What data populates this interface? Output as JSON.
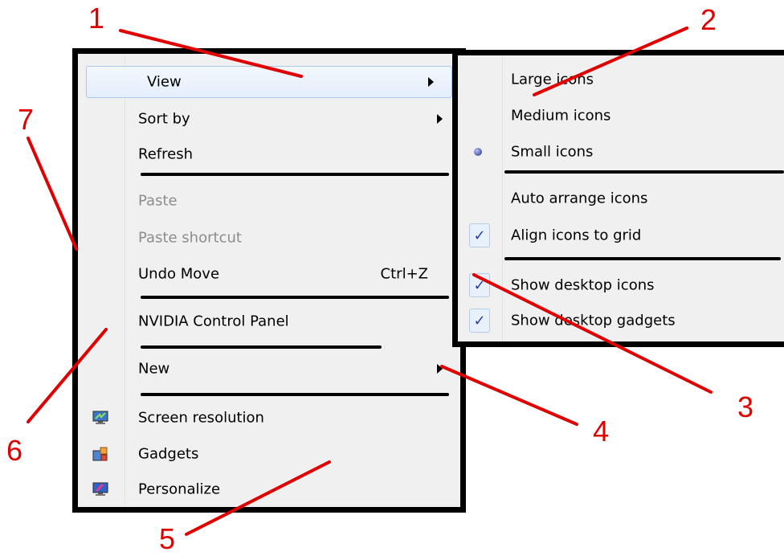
{
  "context_menu": {
    "items": [
      {
        "label": "View",
        "has_submenu": true,
        "highlighted": true
      },
      {
        "label": "Sort by",
        "has_submenu": true
      },
      {
        "label": "Refresh"
      },
      {
        "label": "Paste",
        "disabled": true
      },
      {
        "label": "Paste shortcut",
        "disabled": true
      },
      {
        "label": "Undo Move",
        "shortcut": "Ctrl+Z"
      },
      {
        "label": "NVIDIA Control Panel"
      },
      {
        "label": "New",
        "has_submenu": true
      },
      {
        "label": "Screen resolution",
        "icon": "monitor-icon"
      },
      {
        "label": "Gadgets",
        "icon": "gadgets-icon"
      },
      {
        "label": "Personalize",
        "icon": "personalize-icon"
      }
    ]
  },
  "view_submenu": {
    "items": [
      {
        "label": "Large icons"
      },
      {
        "label": "Medium icons"
      },
      {
        "label": "Small icons",
        "selected": true,
        "mark": "radio-dot"
      },
      {
        "label": "Auto arrange icons"
      },
      {
        "label": "Align icons to grid",
        "checked": true,
        "mark": "✓"
      },
      {
        "label": "Show desktop icons",
        "checked": true,
        "mark": "✓"
      },
      {
        "label": "Show desktop gadgets",
        "checked": true,
        "mark": "✓"
      }
    ]
  },
  "callouts": [
    "1",
    "2",
    "3",
    "4",
    "5",
    "6",
    "7"
  ],
  "colors": {
    "annotation_red": "#e00000",
    "menu_bg": "#f0f0f0",
    "highlight_border": "#a8c8eb",
    "check_color": "#1f3fa3",
    "disabled_text": "#8d8d8d"
  }
}
